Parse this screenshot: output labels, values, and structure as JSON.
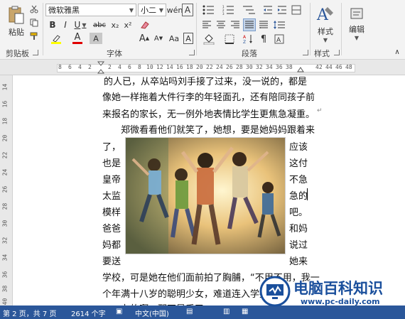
{
  "ribbon": {
    "clipboard": {
      "paste_label": "粘贴",
      "group_label": "剪贴板"
    },
    "font": {
      "font_name": "微软雅黑",
      "font_size": "小二",
      "group_label": "字体",
      "bold": "B",
      "italic": "I",
      "underline": "U",
      "strikethrough": "abc",
      "subscript": "x₂",
      "superscript": "x²",
      "grow": "A",
      "shrink": "A",
      "case": "Aa",
      "clear": "A",
      "highlight": "A",
      "font_color": "A",
      "char_shade": "A",
      "enclose": "A"
    },
    "paragraph": {
      "group_label": "段落"
    },
    "styles": {
      "group_label": "样式",
      "button_label": "样式"
    },
    "editing": {
      "button_label": "编辑"
    }
  },
  "ruler": {
    "tab_selector": "L",
    "h_left": [
      "8",
      "6",
      "4",
      "2",
      "",
      "2",
      "4",
      "6",
      "8",
      "10",
      "12",
      "14",
      "16",
      "18",
      "20",
      "22",
      "24",
      "26",
      "28",
      "30",
      "32",
      "34",
      "36",
      "38",
      "",
      "42",
      "44",
      "46",
      "48"
    ],
    "v": [
      "14",
      "16",
      "18",
      "20",
      "22",
      "24",
      "26",
      "28",
      "30",
      "32",
      "34",
      "36",
      "38",
      "40"
    ]
  },
  "document": {
    "lines": [
      "的人已，从卒站吗刘手接了过来，没一说的，都是",
      "像她一样拖着大件行李的年轻面孔，还有陪同孩子前",
      "来报名的家长，无一例外地表情比学生更焦急凝重。",
      "郑微看看他们就笑了，她想，要是她妈妈跟着来"
    ],
    "left_segments": [
      "了，",
      "也是",
      "皇帝",
      "太监",
      "模样",
      "爸爸",
      "妈都",
      "要送"
    ],
    "right_segments": [
      "应该",
      "这付",
      "不急",
      "急的",
      "吧。",
      "和妈",
      "说过",
      "她来"
    ],
    "bottom_lines": [
      "学校，可是她在他们面前拍了胸脯，“不用不用，我一",
      "个年满十八岁的聪明少女，难道连入学报",
      "办的啊，那不是丢了"
    ]
  },
  "status": {
    "page": "第 2 页，共 7 页",
    "words": "2614 个字",
    "language": "中文(中国)"
  },
  "watermark": {
    "title": "电脑百科知识",
    "url": "www.pc-daily.com"
  },
  "colors": {
    "status_bar": "#2b579a",
    "ribbon_bg": "#f3f3f3",
    "highlight_yellow": "#ffff00",
    "font_red": "#e00000",
    "watermark_blue": "#1a4f9c"
  }
}
